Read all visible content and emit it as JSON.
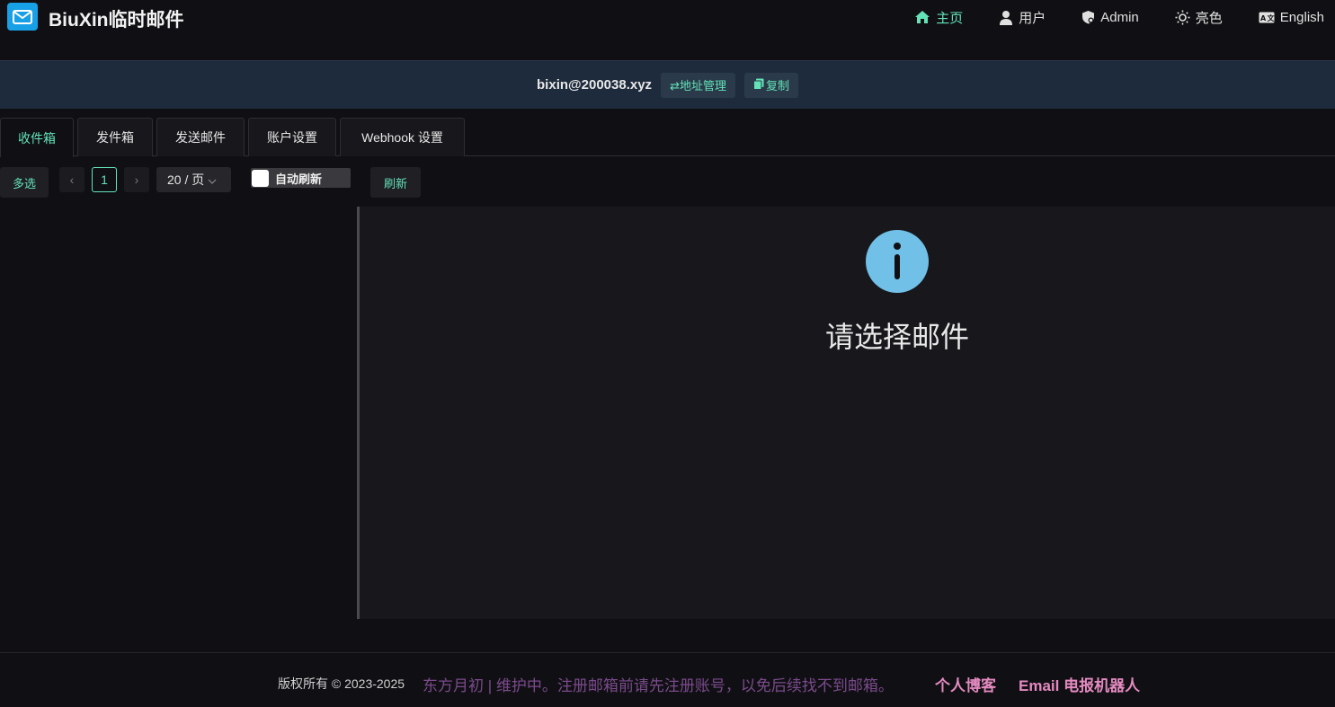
{
  "header": {
    "app_title": "BiuXin临时邮件",
    "nav": [
      {
        "label": "主页",
        "icon": "home-icon",
        "active": true
      },
      {
        "label": "用户",
        "icon": "user-icon",
        "active": false
      },
      {
        "label": "Admin",
        "icon": "shield-icon",
        "active": false
      },
      {
        "label": "亮色",
        "icon": "sun-icon",
        "active": false
      },
      {
        "label": "English",
        "icon": "language-icon",
        "active": false
      }
    ]
  },
  "address_bar": {
    "address": "bixin@200038.xyz",
    "manage_label": "⇄地址管理",
    "copy_label": "复制"
  },
  "tabs": [
    {
      "label": "收件箱",
      "active": true
    },
    {
      "label": "发件箱",
      "active": false
    },
    {
      "label": "发送邮件",
      "active": false
    },
    {
      "label": "账户设置",
      "active": false
    },
    {
      "label": "Webhook 设置",
      "active": false
    }
  ],
  "toolbar": {
    "multi_select_label": "多选",
    "current_page": "1",
    "page_size": "20 / 页",
    "auto_refresh_label": "自动刷新",
    "refresh_label": "刷新"
  },
  "detail": {
    "empty_text": "请选择邮件"
  },
  "footer": {
    "copyright": "版权所有 © 2023-2025",
    "notice": "东方月初 | 维护中。注册邮箱前请先注册账号，以免后续找不到邮箱。",
    "blog_link": "个人博客",
    "bot_link": "Email 电报机器人"
  },
  "colors": {
    "accent": "#63e2b7",
    "background": "#101014",
    "address_bar": "#1e2b3c",
    "info_icon": "#70c0e8",
    "footer_link": "#e48ac0"
  }
}
